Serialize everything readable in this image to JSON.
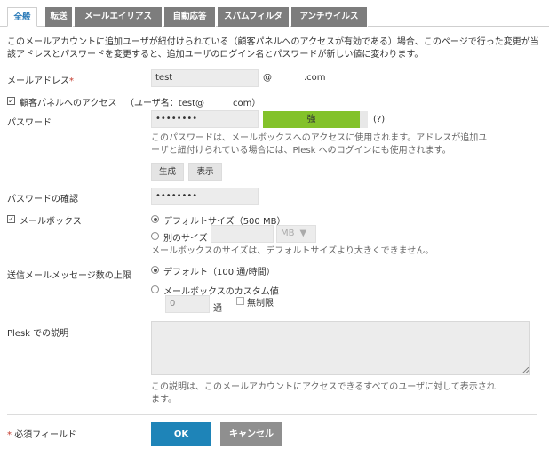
{
  "tabs": [
    {
      "label": "全般"
    },
    {
      "label": "転送"
    },
    {
      "label": "メールエイリアス"
    },
    {
      "label": "自動応答"
    },
    {
      "label": "スパムフィルタ"
    },
    {
      "label": "アンチウイルス"
    }
  ],
  "info_note": "このメールアカウントに追加ユーザが紐付けられている（顧客パネルへのアクセスが有効である）場合、このページで行った変更が当該アドレスとパスワードを変更すると、追加ユーザのログイン名とパスワードが新しい値に変わります。",
  "email": {
    "label": "メールアドレス",
    "required_mark": "*",
    "value": "test",
    "at_sign": "@",
    "domain_suffix": ".com"
  },
  "customer_panel": {
    "checked": true,
    "label": "顧客パネルへのアクセス",
    "username_prefix": "（ユーザ名：test@",
    "username_suffix": "com）"
  },
  "password": {
    "label": "パスワード",
    "value": "••••••••",
    "strength_label": "強",
    "strength_level": 0.92,
    "help_link": "(?)",
    "hint": "このパスワードは、メールボックスへのアクセスに使用されます。アドレスが追加ユーザと紐付けられている場合には、Plesk へのログインにも使用されます。",
    "generate_button": "生成",
    "show_button": "表示"
  },
  "password_confirm": {
    "label": "パスワードの確認",
    "value": "••••••••"
  },
  "mailbox": {
    "checked": true,
    "label": "メールボックス",
    "option_default": "デフォルトサイズ（500 MB）",
    "option_custom": "別のサイズ",
    "unit_value": "MB",
    "hint": "メールボックスのサイズは、デフォルトサイズより大きくできません。"
  },
  "outgoing_limit": {
    "label": "送信メールメッセージ数の上限",
    "option_default": "デフォルト（100 通/時間）",
    "option_custom": "メールボックスのカスタム値",
    "custom_value": "0",
    "unit": "通",
    "unlimited_label": "無制限"
  },
  "description": {
    "label": "Plesk での説明",
    "value": "",
    "hint": "この説明は、このメールアカウントにアクセスできるすべてのユーザに対して表示されます。"
  },
  "footer": {
    "required_mark": "*",
    "required_note": "必須フィールド",
    "ok_button": "OK",
    "cancel_button": "キャンセル"
  },
  "colors": {
    "accent": "#1e84b8",
    "strength": "#83c22a",
    "tab_inactive": "#7d7d7d",
    "required": "#c43b2e"
  }
}
